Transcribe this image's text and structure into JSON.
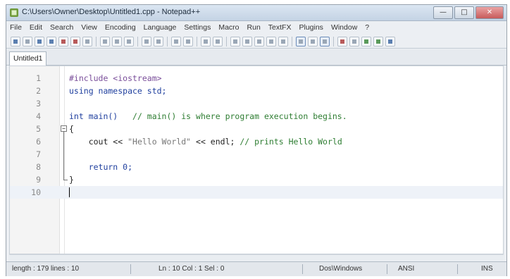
{
  "window": {
    "title": "C:\\Users\\Owner\\Desktop\\Untitled1.cpp - Notepad++",
    "controls": {
      "minimize": "—",
      "maximize": "□",
      "close": "✕"
    }
  },
  "menubar": {
    "items": [
      "File",
      "Edit",
      "Search",
      "View",
      "Encoding",
      "Language",
      "Settings",
      "Macro",
      "Run",
      "TextFX",
      "Plugins",
      "Window",
      "?"
    ]
  },
  "tab": {
    "label": "Untitled1"
  },
  "editor": {
    "lines": [
      {
        "num": "1",
        "segments": [
          {
            "text": "#include <iostream>",
            "cls": "pp"
          }
        ]
      },
      {
        "num": "2",
        "segments": [
          {
            "text": "using namespace std;",
            "cls": "kw"
          }
        ]
      },
      {
        "num": "3",
        "segments": []
      },
      {
        "num": "4",
        "segments": [
          {
            "text": "int main()",
            "cls": "kw"
          },
          {
            "text": "   // main() is where program execution begins.",
            "cls": "cmt"
          }
        ]
      },
      {
        "num": "5",
        "segments": [
          {
            "text": "{",
            "cls": ""
          }
        ]
      },
      {
        "num": "6",
        "segments": [
          {
            "text": "    cout << ",
            "cls": ""
          },
          {
            "text": "\"Hello World\"",
            "cls": "str"
          },
          {
            "text": " << endl; ",
            "cls": ""
          },
          {
            "text": "// prints Hello World",
            "cls": "cmt"
          }
        ]
      },
      {
        "num": "7",
        "segments": []
      },
      {
        "num": "8",
        "segments": [
          {
            "text": "    return 0;",
            "cls": "kw"
          }
        ]
      },
      {
        "num": "9",
        "segments": [
          {
            "text": "}",
            "cls": ""
          }
        ]
      },
      {
        "num": "10",
        "segments": []
      }
    ],
    "current_line": 10
  },
  "status": {
    "length": "length : 179   lines : 10",
    "position": "Ln : 10   Col : 1   Sel : 0",
    "eol": "Dos\\Windows",
    "encoding": "ANSI",
    "mode": "INS"
  }
}
